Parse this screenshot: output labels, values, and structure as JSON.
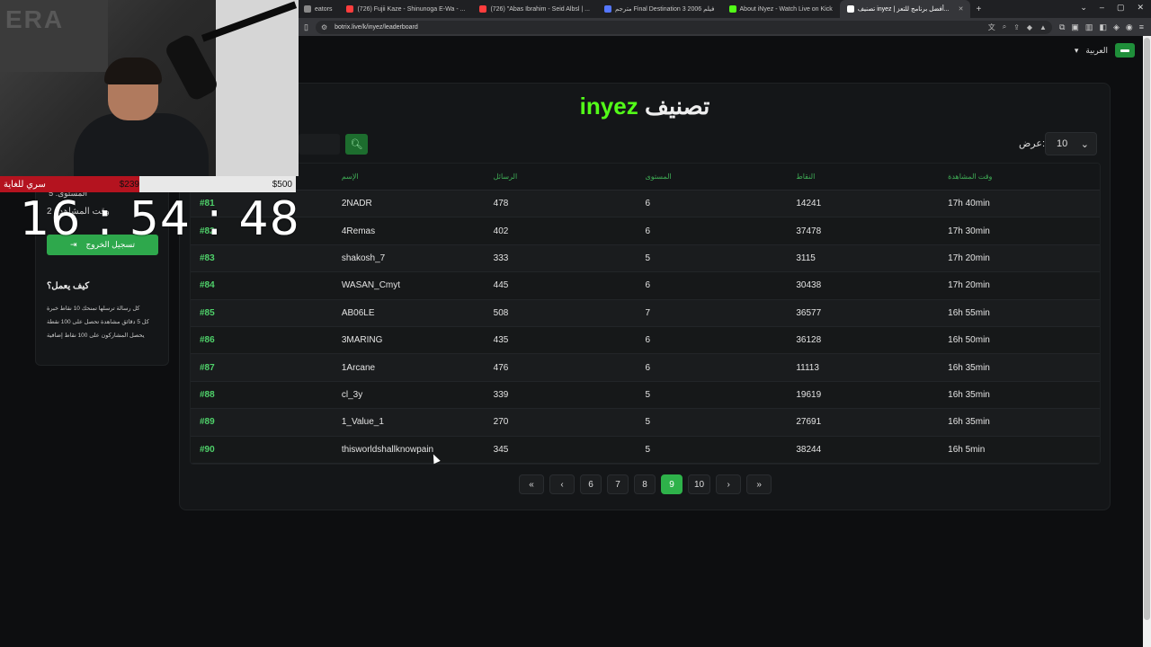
{
  "browser": {
    "tabs": [
      {
        "label": "eators",
        "color": "#888888"
      },
      {
        "label": "(726) Fujii Kaze - Shinunoga E-Wa - ...",
        "color": "#ff3d3d"
      },
      {
        "label": "(726) \"Abas Ibrahim - Seid Albsl | ...",
        "color": "#ff3d3d"
      },
      {
        "label": "مترجم Final Destination 3 2006 فيلم",
        "color": "#5577ff"
      },
      {
        "label": "About iNyez - Watch Live on Kick",
        "color": "#53fc18"
      },
      {
        "label": "تصنيف inyez | أفضل برنامج للتعز...",
        "color": "#ffffff",
        "active": true
      }
    ],
    "url": "botrix.live/k/inyez/leaderboard"
  },
  "header": {
    "language": "العربية",
    "title_brand": "inyez",
    "title_word": "تصنيف"
  },
  "controls": {
    "show_label": "عرض:",
    "show_value": "10"
  },
  "table": {
    "columns": [
      "",
      "الإسم",
      "الرسائل",
      "المستوى",
      "النقاط",
      "وقت المشاهدة"
    ],
    "rows": [
      {
        "rank": "#81",
        "name": "2NADR",
        "messages": "478",
        "level": "6",
        "points": "14241",
        "watch": "17h 40min"
      },
      {
        "rank": "#82",
        "name": "4Remas",
        "messages": "402",
        "level": "6",
        "points": "37478",
        "watch": "17h 30min"
      },
      {
        "rank": "#83",
        "name": "shakosh_7",
        "messages": "333",
        "level": "5",
        "points": "3115",
        "watch": "17h 20min"
      },
      {
        "rank": "#84",
        "name": "WASAN_Cmyt",
        "messages": "445",
        "level": "6",
        "points": "30438",
        "watch": "17h 20min"
      },
      {
        "rank": "#85",
        "name": "AB06LE",
        "messages": "508",
        "level": "7",
        "points": "36577",
        "watch": "16h 55min"
      },
      {
        "rank": "#86",
        "name": "3MARING",
        "messages": "435",
        "level": "6",
        "points": "36128",
        "watch": "16h 50min"
      },
      {
        "rank": "#87",
        "name": "1Arcane",
        "messages": "476",
        "level": "6",
        "points": "11113",
        "watch": "16h 35min"
      },
      {
        "rank": "#88",
        "name": "cl_3y",
        "messages": "339",
        "level": "5",
        "points": "19619",
        "watch": "16h 35min"
      },
      {
        "rank": "#89",
        "name": "1_Value_1",
        "messages": "270",
        "level": "5",
        "points": "27691",
        "watch": "16h 35min"
      },
      {
        "rank": "#90",
        "name": "thisworldshallknowpain",
        "messages": "345",
        "level": "5",
        "points": "38244",
        "watch": "16h 5min"
      }
    ]
  },
  "pagination": {
    "pages": [
      "6",
      "7",
      "8",
      "9",
      "10"
    ],
    "current": "9"
  },
  "sidebar": {
    "level_line": "المستوى: 5",
    "watch_line": "2",
    "watch_text": "h 30m",
    "watch_label": "وقت المشاهدة",
    "logout_label": "تسجيل الخروج",
    "how_title": "كيف يعمل؟",
    "info": [
      "كل رسالة ترسلها تمنحك 10 نقاط خبرة",
      "كل 5 دقائق مشاهدة تحصل على 100 نقطة",
      "يحصل المشاركون على 100 نقاط إضافية"
    ]
  },
  "overlay": {
    "goal_label": "سري للغاية",
    "goal_current": "$239",
    "goal_target": "$500",
    "clock": "16 : 54 : 48",
    "watermark": "ERA"
  }
}
